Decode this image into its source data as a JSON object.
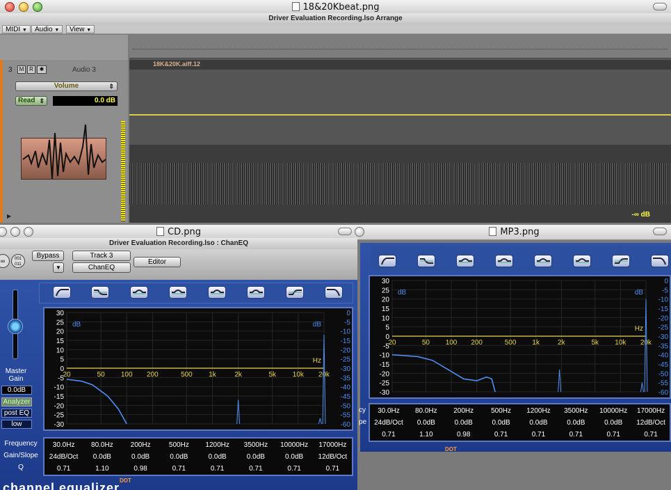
{
  "arrange_window": {
    "title": "18&20Kbeat.png",
    "subtitle": "Driver Evaluation Recording.lso Arrange",
    "menus": [
      "MIDI",
      "Audio",
      "View"
    ],
    "track": {
      "number": "3",
      "buttons": [
        "M",
        "R",
        "✱"
      ],
      "name": "Audio 3",
      "parameter": "Volume",
      "automation_mode": "Read",
      "value": "0.0 dB"
    },
    "region_name": "18K&20K.aiff.12",
    "level_readout": "-∞ dB"
  },
  "cd_window": {
    "title": "CD.png",
    "subtitle": "Driver Evaluation Recording.lso : ChanEQ",
    "icon_labels": [
      "001\n011"
    ],
    "bypass_label": "Bypass",
    "track_label": "Track 3",
    "plugin_label": "ChanEQ",
    "editor_label": "Editor",
    "master_gain_label": "Master Gain",
    "master_gain_value": "0.0dB",
    "analyzer_label": "Analyzer",
    "post_eq_label": "post EQ",
    "resolution_label": "low",
    "brand_text": "channel equalizer",
    "brand_dot": "DOT",
    "row_labels": {
      "frequency": "Frequency",
      "gain_slope": "Gain/Slope",
      "q": "Q"
    }
  },
  "mp3_window": {
    "title": "MP3.png",
    "brand_dot": "DOT",
    "row_labels_partial": {
      "frequency": "cy",
      "gain_slope": "pe"
    }
  },
  "eq": {
    "left_axis": [
      "30",
      "25",
      "20",
      "15",
      "10",
      "5",
      "0",
      "-5",
      "-10",
      "-15",
      "-20",
      "-25",
      "-30"
    ],
    "right_axis": [
      "0",
      "-5",
      "-10",
      "-15",
      "-20",
      "-25",
      "-30",
      "-35",
      "-40",
      "-45",
      "-50",
      "-55",
      "-60"
    ],
    "freq_labels": [
      "20",
      "50",
      "100",
      "200",
      "500",
      "1k",
      "2k",
      "5k",
      "10k",
      "20k"
    ],
    "unit_db_left": "dB",
    "unit_db_right": "dB",
    "unit_hz": "Hz",
    "bands": [
      {
        "freq": "30.0Hz",
        "gain": "24dB/Oct",
        "q": "0.71"
      },
      {
        "freq": "80.0Hz",
        "gain": "0.0dB",
        "q": "1.10"
      },
      {
        "freq": "200Hz",
        "gain": "0.0dB",
        "q": "0.98"
      },
      {
        "freq": "500Hz",
        "gain": "0.0dB",
        "q": "0.71"
      },
      {
        "freq": "1200Hz",
        "gain": "0.0dB",
        "q": "0.71"
      },
      {
        "freq": "3500Hz",
        "gain": "0.0dB",
        "q": "0.71"
      },
      {
        "freq": "10000Hz",
        "gain": "0.0dB",
        "q": "0.71"
      },
      {
        "freq": "17000Hz",
        "gain": "12dB/Oct",
        "q": "0.71"
      }
    ],
    "band_shape_icons": [
      "lowcut-icon",
      "lowshelf-icon",
      "bell-icon",
      "bell-icon",
      "bell-icon",
      "bell-icon",
      "highshelf-icon",
      "highcut-icon"
    ]
  },
  "colors": {
    "eq_panel": "#1d3a8a",
    "curve": "#4f8ef0",
    "zero_line": "#c8b44a",
    "axis_text": "#e8d24a",
    "readout_text": "#ffff44"
  }
}
